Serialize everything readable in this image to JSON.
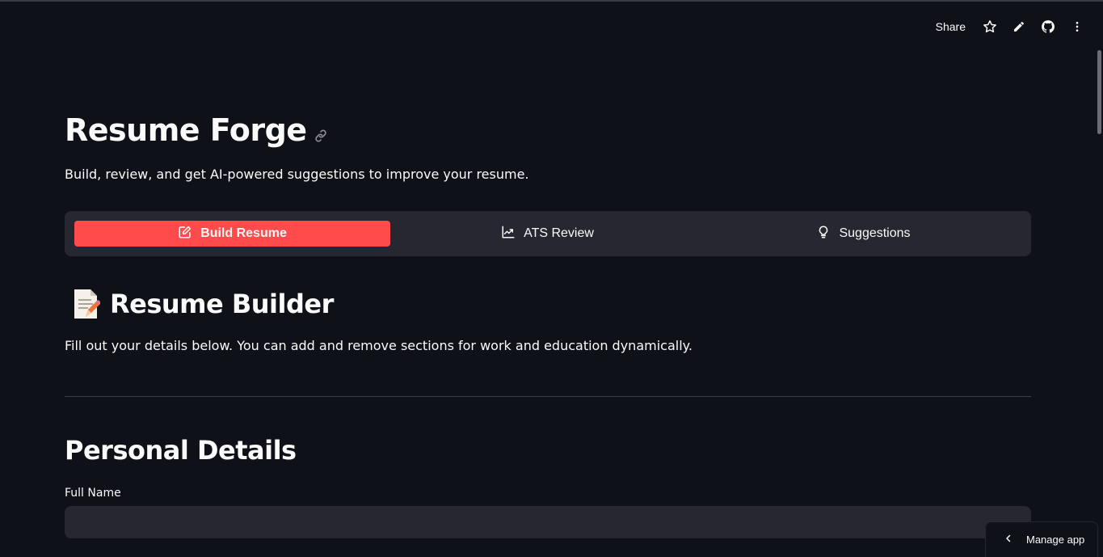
{
  "toolbar": {
    "share_label": "Share",
    "icons": [
      "star-icon",
      "pencil-icon",
      "github-icon",
      "more-vert-icon"
    ]
  },
  "header": {
    "title": "Resume Forge",
    "subtitle": "Build, review, and get AI-powered suggestions to improve your resume."
  },
  "tabs": [
    {
      "label": "Build Resume",
      "icon": "edit-note-icon",
      "active": true
    },
    {
      "label": "ATS Review",
      "icon": "trending-up-icon",
      "active": false
    },
    {
      "label": "Suggestions",
      "icon": "lightbulb-icon",
      "active": false
    }
  ],
  "builder": {
    "heading": "Resume Builder",
    "emoji_icon": "memo-icon",
    "description": "Fill out your details below. You can add and remove sections for work and education dynamically."
  },
  "personal": {
    "heading": "Personal Details",
    "full_name_label": "Full Name",
    "full_name_value": ""
  },
  "footer": {
    "manage_app_label": "Manage app"
  },
  "colors": {
    "background": "#0e1117",
    "surface": "#262730",
    "accent": "#ff4b4b",
    "text": "#fafafa"
  }
}
